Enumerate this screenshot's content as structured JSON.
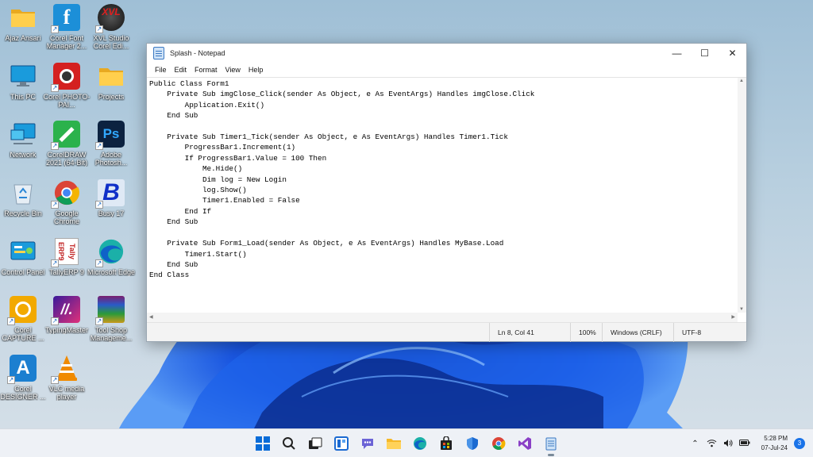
{
  "desktop": {
    "icons": [
      {
        "label": "Ajaz Ansari",
        "icon": "folder-icon"
      },
      {
        "label": "Corel Font Manager 2...",
        "icon": "corel-font-manager-icon"
      },
      {
        "label": "XVL Studio Corel Edi...",
        "icon": "xvl-studio-icon"
      },
      {
        "label": "This PC",
        "icon": "this-pc-icon"
      },
      {
        "label": "Corel PHOTO-PAI...",
        "icon": "corel-photo-paint-icon"
      },
      {
        "label": "Projects",
        "icon": "folder-icon"
      },
      {
        "label": "Network",
        "icon": "network-icon"
      },
      {
        "label": "CorelDRAW 2021 (64-Bit)",
        "icon": "coreldraw-icon"
      },
      {
        "label": "Adobe Photosh...",
        "icon": "photoshop-icon"
      },
      {
        "label": "Recycle Bin",
        "icon": "recycle-bin-icon"
      },
      {
        "label": "Google Chrome",
        "icon": "chrome-icon"
      },
      {
        "label": "Busy 17",
        "icon": "busy-icon"
      },
      {
        "label": "Control Panel",
        "icon": "control-panel-icon"
      },
      {
        "label": "TallyERP 9",
        "icon": "tally-icon"
      },
      {
        "label": "Microsoft Edge",
        "icon": "edge-icon"
      },
      {
        "label": "Corel CAPTURE ...",
        "icon": "corel-capture-icon"
      },
      {
        "label": "TypingMaster",
        "icon": "typingmaster-icon"
      },
      {
        "label": "Tool Shop Manageme...",
        "icon": "winrar-icon"
      },
      {
        "label": "Corel DESIGNER ...",
        "icon": "corel-designer-icon"
      },
      {
        "label": "VLC media player",
        "icon": "vlc-icon"
      }
    ]
  },
  "notepad": {
    "title": "Splash - Notepad",
    "controls": {
      "minimize": "—",
      "maximize": "☐",
      "close": "✕"
    },
    "menu": [
      "File",
      "Edit",
      "Format",
      "View",
      "Help"
    ],
    "content": "Public Class Form1\n    Private Sub imgClose_Click(sender As Object, e As EventArgs) Handles imgClose.Click\n        Application.Exit()\n    End Sub\n\n    Private Sub Timer1_Tick(sender As Object, e As EventArgs) Handles Timer1.Tick\n        ProgressBar1.Increment(1)\n        If ProgressBar1.Value = 100 Then\n            Me.Hide()\n            Dim log = New Login\n            log.Show()\n            Timer1.Enabled = False\n        End If\n    End Sub\n\n    Private Sub Form1_Load(sender As Object, e As EventArgs) Handles MyBase.Load\n        Timer1.Start()\n    End Sub\nEnd Class",
    "status": {
      "position": "Ln 8, Col 41",
      "zoom": "100%",
      "line_ending": "Windows (CRLF)",
      "encoding": "UTF-8"
    }
  },
  "taskbar": {
    "apps": [
      "windows-start-icon",
      "search-icon",
      "task-view-icon",
      "widgets-icon",
      "teams-chat-icon",
      "file-explorer-icon",
      "edge-icon",
      "store-icon",
      "defender-icon",
      "chrome-icon",
      "visual-studio-icon",
      "notepad-icon"
    ],
    "tray": {
      "time": "5:28 PM",
      "date": "07-Jul-24",
      "notifications": "3"
    }
  }
}
